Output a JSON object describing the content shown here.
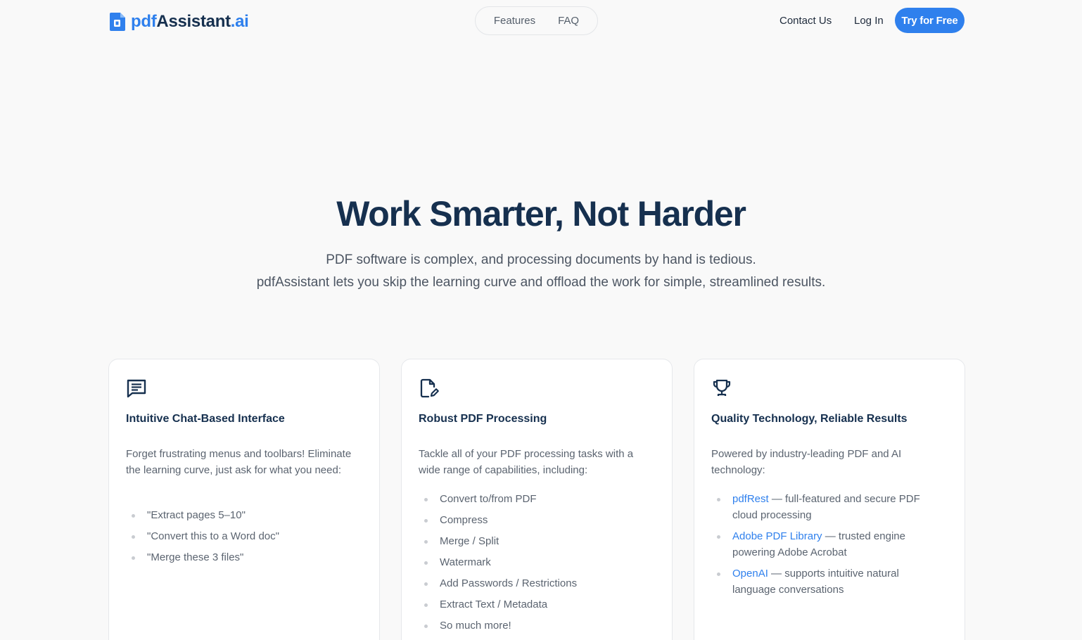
{
  "header": {
    "logo": {
      "part1": "pdf",
      "part2": "Assistant",
      "part3": ".ai"
    },
    "nav": [
      {
        "label": "Features"
      },
      {
        "label": "FAQ"
      }
    ],
    "contact_label": "Contact Us",
    "login_label": "Log In",
    "cta_label": "Try for Free"
  },
  "hero": {
    "title": "Work Smarter, Not Harder",
    "subtitle_line1": "PDF software is complex, and processing documents by hand is tedious.",
    "subtitle_line2": "pdfAssistant lets you skip the learning curve and offload the work for simple, streamlined results."
  },
  "cards": [
    {
      "icon": "chat-icon",
      "title": "Intuitive Chat-Based Interface",
      "description": "Forget frustrating menus and toolbars! Eliminate the learning curve, just ask for what you need:",
      "items": [
        "\"Extract pages 5–10\"",
        "\"Convert this to a Word doc\"",
        "\"Merge these 3 files\""
      ]
    },
    {
      "icon": "file-edit-icon",
      "title": "Robust PDF Processing",
      "description": "Tackle all of your PDF processing tasks with a wide range of capabilities, including:",
      "items": [
        "Convert to/from PDF",
        "Compress",
        "Merge / Split",
        "Watermark",
        "Add Passwords / Restrictions",
        "Extract Text / Metadata",
        "So much more!"
      ]
    },
    {
      "icon": "trophy-icon",
      "title": "Quality Technology, Reliable Results",
      "description": "Powered by industry-leading PDF and AI technology:",
      "items": [
        {
          "link": "pdfRest",
          "text": " — full-featured and secure PDF cloud processing"
        },
        {
          "link": "Adobe PDF Library",
          "text": " — trusted engine powering Adobe Acrobat"
        },
        {
          "link": "OpenAI",
          "text": " — supports intuitive natural language conversations"
        }
      ]
    }
  ],
  "colors": {
    "accent": "#2f80ed",
    "heading": "#16304f",
    "body_text": "#5b6470",
    "background": "#f9f9f9"
  }
}
